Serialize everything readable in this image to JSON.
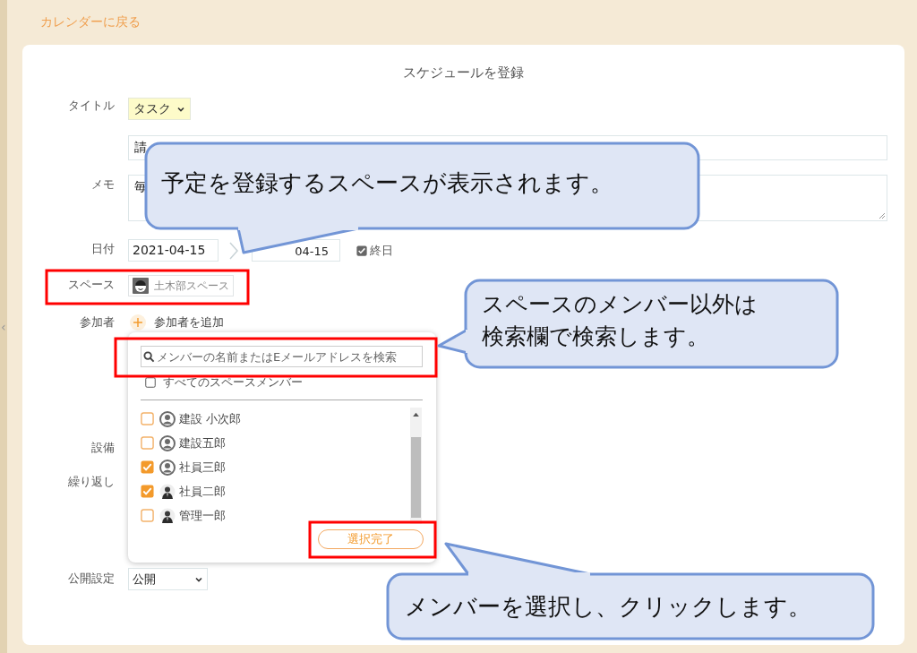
{
  "sidebar_toggle": "‹",
  "back_link": "カレンダーに戻る",
  "heading": "スケジュールを登録",
  "form": {
    "title_label": "タイトル",
    "category": "タスク",
    "title_value": "請",
    "memo_label": "メモ",
    "memo_value": "毎",
    "date_label": "日付",
    "start_date": "2021-04-15",
    "end_date": "04-15",
    "all_day": {
      "label": "終日",
      "checked": true
    },
    "space_label": "スペース",
    "space": "土木部スペース",
    "participants_label": "参加者",
    "add_participant": "参加者を追加",
    "equipment_label": "設備",
    "repeat_label": "繰り返し",
    "visibility_label": "公開設定",
    "visibility": "公開"
  },
  "member_picker": {
    "search_placeholder": "メンバーの名前またはEメールアドレスを検索",
    "all_members": {
      "label": "すべてのスペースメンバー",
      "checked": false
    },
    "members": [
      {
        "name": "建設 小次郎",
        "checked": false,
        "kind": "default"
      },
      {
        "name": "建設五郎",
        "checked": false,
        "kind": "default"
      },
      {
        "name": "社員三郎",
        "checked": true,
        "kind": "default"
      },
      {
        "name": "社員二郎",
        "checked": true,
        "kind": "photo"
      },
      {
        "name": "管理一郎",
        "checked": false,
        "kind": "photo"
      }
    ],
    "done_button": "選択完了"
  },
  "callouts": [
    {
      "text": "予定を登録するスペースが表示されます。"
    },
    {
      "text": "スペースのメンバー以外は検索欄で検索します。"
    },
    {
      "text": "メンバーを選択し、クリックします。"
    }
  ]
}
